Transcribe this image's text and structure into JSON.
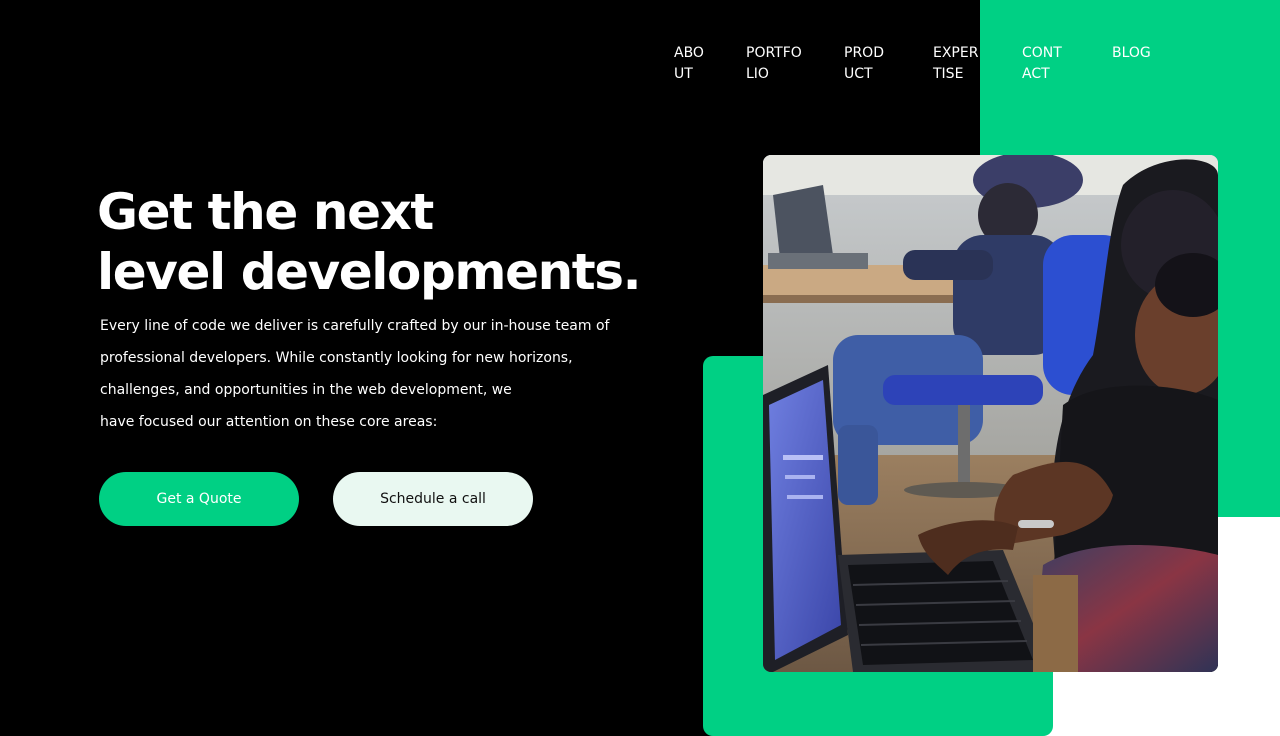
{
  "nav": {
    "items": [
      {
        "label": "ABOUT"
      },
      {
        "label": "PORTFOLIO"
      },
      {
        "label": "PRODUCT"
      },
      {
        "label": "EXPERTISE"
      },
      {
        "label": "CONTACT"
      },
      {
        "label": "BLOG"
      }
    ]
  },
  "hero": {
    "title_line1": "Get the next",
    "title_line2": "level developments.",
    "description_lines": [
      "Every line of code we deliver is carefully crafted by our in-house team of",
      "professional developers. While constantly looking for new horizons,",
      "challenges, and opportunities in the web development, we",
      "have focused our attention on these core areas:"
    ],
    "quote_button": "Get a Quote",
    "call_button": "Schedule a call"
  },
  "colors": {
    "background": "#000000",
    "accent_green": "#00d084",
    "light_button": "#e9f8f1",
    "white": "#ffffff"
  }
}
